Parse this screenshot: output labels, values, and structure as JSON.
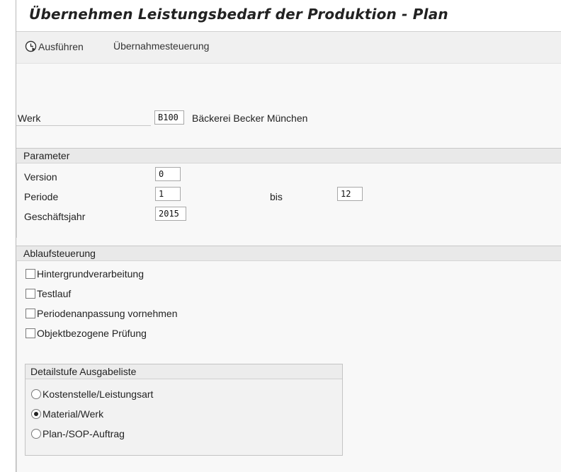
{
  "window": {
    "title": "Übernehmen Leistungsbedarf der Produktion - Plan"
  },
  "toolbar": {
    "execute_label": "Ausführen",
    "control_label": "Übernahmesteuerung"
  },
  "header_fields": {
    "werk_label": "Werk",
    "werk_value": "B100",
    "werk_description": "Bäckerei Becker München"
  },
  "parameter": {
    "title": "Parameter",
    "version_label": "Version",
    "version_value": "0",
    "periode_label": "Periode",
    "periode_value": "1",
    "bis_label": "bis",
    "bis_value": "12",
    "jahr_label": "Geschäftsjahr",
    "jahr_value": "2015"
  },
  "ablauf": {
    "title": "Ablaufsteuerung",
    "options": [
      {
        "label": "Hintergrundverarbeitung",
        "checked": false
      },
      {
        "label": "Testlauf",
        "checked": false
      },
      {
        "label": "Periodenanpassung vornehmen",
        "checked": false
      },
      {
        "label": "Objektbezogene Prüfung",
        "checked": false
      }
    ]
  },
  "detail": {
    "title": "Detailstufe Ausgabeliste",
    "options": [
      {
        "label": "Kostenstelle/Leistungsart",
        "selected": false
      },
      {
        "label": "Material/Werk",
        "selected": true
      },
      {
        "label": "Plan-/SOP-Auftrag",
        "selected": false
      }
    ]
  }
}
